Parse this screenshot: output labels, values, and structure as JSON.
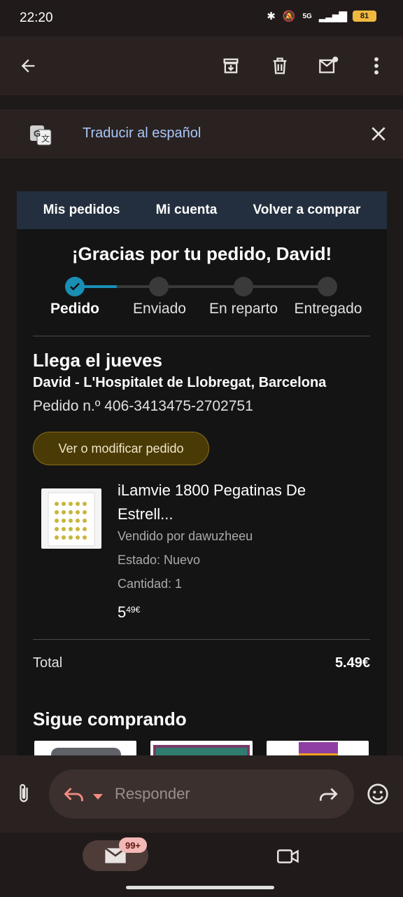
{
  "status_bar": {
    "time": "22:20",
    "battery": "81",
    "network": "5G"
  },
  "toolbar": {
    "back_icon": "back-arrow-icon",
    "archive_icon": "archive-icon",
    "delete_icon": "trash-icon",
    "unread_icon": "mark-unread-icon",
    "more_icon": "more-vert-icon"
  },
  "translate_bar": {
    "label": "Traducir al español"
  },
  "email": {
    "nav_tabs": [
      "Mis pedidos",
      "Mi cuenta",
      "Volver a comprar"
    ],
    "thanks": "¡Gracias por tu pedido, David!",
    "progress": {
      "steps": [
        "Pedido",
        "Enviado",
        "En reparto",
        "Entregado"
      ],
      "current": 0
    },
    "arrival": "Llega el jueves",
    "address": "David - L'Hospitalet de Llobregat, Barcelona",
    "order_number": "Pedido n.º 406-3413475-2702751",
    "view_button": "Ver o modificar pedido",
    "product": {
      "name": "iLamvie 1800 Pegatinas De Estrell...",
      "seller": "Vendido por dawuzheeu",
      "condition": "Estado: Nuevo",
      "quantity": "Cantidad: 1",
      "price_whole": "5",
      "price_fraction": "49€"
    },
    "total_label": "Total",
    "total_value": "5.49€",
    "keep_shopping": "Sigue comprando"
  },
  "compose": {
    "placeholder": "Responder"
  },
  "bottom_nav": {
    "badge": "99+"
  }
}
